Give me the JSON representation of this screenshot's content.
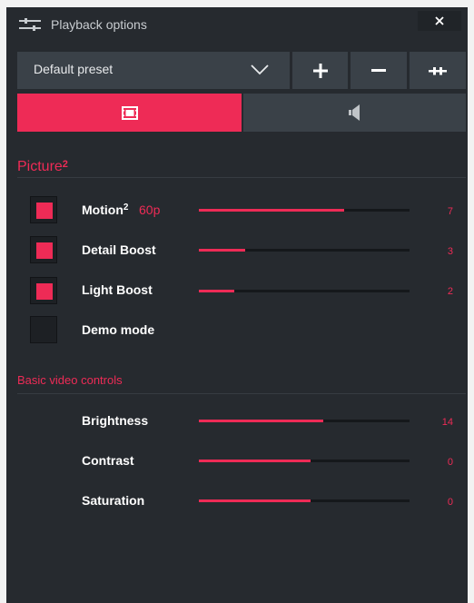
{
  "window": {
    "title": "Playback options",
    "title_icon": "sliders-icon",
    "close_icon": "close-icon"
  },
  "toolbar": {
    "preset_label": "Default preset",
    "chevron_icon": "chevron-down-icon",
    "add_icon": "plus-icon",
    "remove_icon": "minus-icon",
    "compare_icon": "split-compare-icon"
  },
  "tabs": [
    {
      "icon": "film-icon",
      "active": true
    },
    {
      "icon": "speaker-icon",
      "active": false
    }
  ],
  "picture": {
    "title": "Picture",
    "title_sup": "2",
    "rows": [
      {
        "label": "Motion",
        "label_sup": "2",
        "extra": "60p",
        "checked": true,
        "value": "7",
        "fill_fraction": 0.69
      },
      {
        "label": "Detail Boost",
        "checked": true,
        "value": "3",
        "fill_fraction": 0.22
      },
      {
        "label": "Light Boost",
        "checked": true,
        "value": "2",
        "fill_fraction": 0.17
      },
      {
        "label": "Demo mode",
        "checked": false
      }
    ]
  },
  "basic": {
    "title": "Basic video controls",
    "rows": [
      {
        "label": "Brightness",
        "value": "14",
        "fill_fraction": 0.59
      },
      {
        "label": "Contrast",
        "value": "0",
        "fill_fraction": 0.53
      },
      {
        "label": "Saturation",
        "value": "0",
        "fill_fraction": 0.53
      }
    ]
  },
  "colors": {
    "accent": "#ee2b56",
    "panel": "#262a2f",
    "control": "#3a4148",
    "track": "#15181b"
  }
}
